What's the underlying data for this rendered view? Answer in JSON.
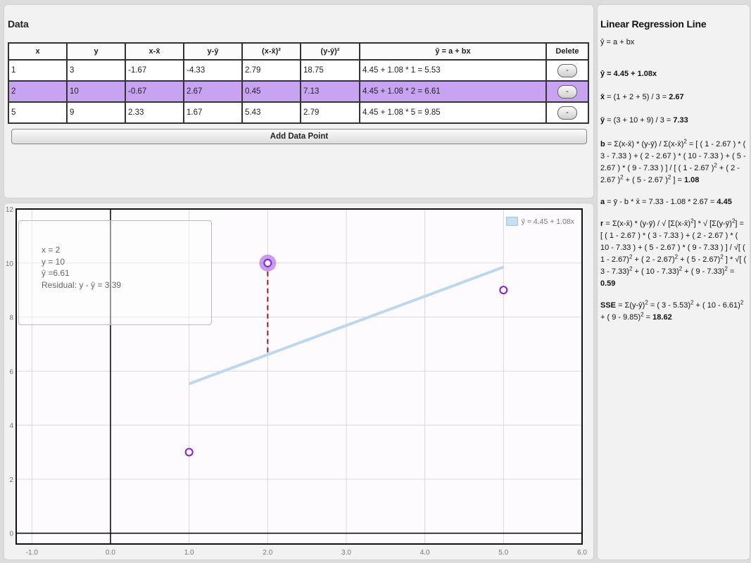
{
  "data_panel": {
    "title": "Data",
    "headers": [
      "x",
      "y",
      "x-x̄",
      "y-ȳ",
      "(x-x̄)²",
      "(y-ȳ)²",
      "ŷ = a + bx",
      "Delete"
    ],
    "rows": [
      {
        "x": "1",
        "y": "3",
        "dx": "-1.67",
        "dy": "-4.33",
        "dx2": "2.79",
        "dy2": "18.75",
        "yhat": "4.45 + 1.08 * 1 = 5.53",
        "delete": "-"
      },
      {
        "x": "2",
        "y": "10",
        "dx": "-0.67",
        "dy": "2.67",
        "dx2": "0.45",
        "dy2": "7.13",
        "yhat": "4.45 + 1.08 * 2 = 6.61",
        "delete": "-"
      },
      {
        "x": "5",
        "y": "9",
        "dx": "2.33",
        "dy": "1.67",
        "dx2": "5.43",
        "dy2": "2.79",
        "yhat": "4.45 + 1.08 * 5 = 9.85",
        "delete": "-"
      }
    ],
    "selected_row": 1,
    "add_button": "Add Data Point"
  },
  "chart": {
    "tooltip": {
      "line1": "x = 2",
      "line2": "y = 10",
      "line3": "ŷ =6.61",
      "line4": "Residual: y - ŷ = 3.39"
    },
    "legend": "ŷ = 4.45 + 1.08x",
    "colors": {
      "line": "#bcd7ee",
      "point": "#8a1ad6",
      "highlight": "#b47ee6",
      "residual": "#9e1b1b",
      "plot_bg": "#fdfbfe",
      "grid": "#d9d9d9",
      "axis": "#111111"
    }
  },
  "chart_data": {
    "type": "scatter",
    "points": [
      {
        "x": 1,
        "y": 3
      },
      {
        "x": 2,
        "y": 10
      },
      {
        "x": 5,
        "y": 9
      }
    ],
    "highlighted_point": {
      "x": 2,
      "y": 10
    },
    "regression_line": {
      "a": 4.45,
      "b": 1.08,
      "x_range": [
        1,
        5
      ]
    },
    "residual": {
      "x": 2,
      "y_from": 10,
      "y_to": 6.61
    },
    "xlim": [
      -1.2,
      6.0
    ],
    "ylim": [
      -0.4,
      12.0
    ],
    "x_ticks": [
      "-1.0",
      "0.0",
      "1.0",
      "2.0",
      "3.0",
      "4.0",
      "5.0",
      "6.0"
    ],
    "y_ticks": [
      "0",
      "2",
      "4",
      "6",
      "8",
      "10",
      "12"
    ],
    "grid": true
  },
  "regression": {
    "title": "Linear Regression Line",
    "formula": "ŷ = a + bx",
    "equation": "ŷ = 4.45 + 1.08x",
    "xbar_label": "x̄",
    "xbar_expr": " = (1 + 2 + 5) / 3 = ",
    "xbar_val": "2.67",
    "ybar_label": "ȳ",
    "ybar_expr": " = (3 + 10 + 9) / 3 = ",
    "ybar_val": "7.33",
    "b_label": "b",
    "b_p1": " = Σ(x-x̄) * (y-ȳ) / Σ(x-x̄)",
    "b_p2": " = [ ( 1 - 2.67 ) * ( 3 - 7.33 ) + ( 2 - 2.67 ) * ( 10 - 7.33 ) + ( 5 - 2.67 ) * ( 9 - 7.33 ) ] / [ ( 1 - 2.67 )",
    "b_p3": " + ( 2 - 2.67 )",
    "b_p4": " + ( 5 - 2.67 )",
    "b_p5": " ] = ",
    "b_val": "1.08",
    "a_label": "a",
    "a_expr": " = ȳ - b * x̄ = 7.33 - 1.08 * 2.67 = ",
    "a_val": "4.45",
    "r_label": "r",
    "r_p1": " = Σ(x-x̄) * (y-ȳ) / √ [Σ(x-x̄)",
    "r_p2": "] * √ [Σ(y-ȳ)",
    "r_p3": "] = [ ( 1 - 2.67 ) * ( 3 - 7.33 ) + ( 2 - 2.67 ) * ( 10 - 7.33 ) + ( 5 - 2.67 ) * ( 9 - 7.33 ) ] / √[ ( 1 - 2.67)",
    "r_p4": " + ( 2 - 2.67)",
    "r_p5": " + ( 5 - 2.67)",
    "r_p6": " ] * √[ ( 3 - 7.33)",
    "r_p7": " + ( 10 - 7.33)",
    "r_p8": " + ( 9 - 7.33)",
    "r_p9": " = ",
    "r_val": "0.59",
    "sse_label": "SSE",
    "sse_p1": " = Σ(y-ŷ)",
    "sse_p2": " = ( 3 - 5.53)",
    "sse_p3": " + ( 10 - 6.61)",
    "sse_p4": " + ( 9 - 9.85)",
    "sse_p5": " = ",
    "sse_val": "18.62",
    "sup2": "2"
  }
}
